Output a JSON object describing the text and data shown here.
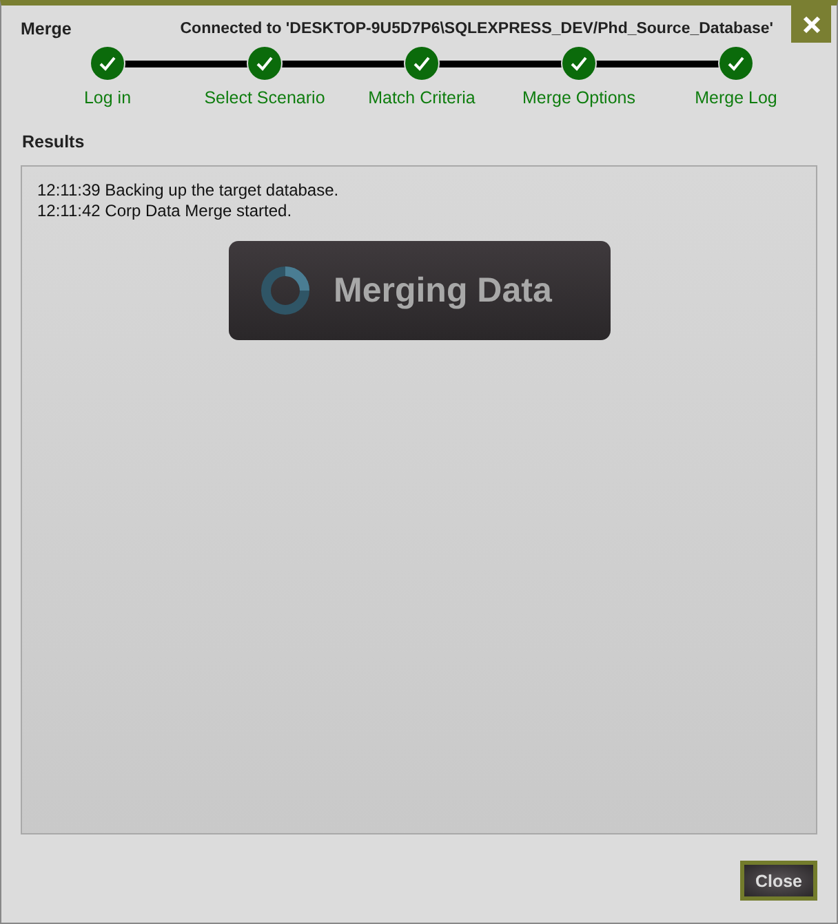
{
  "window": {
    "title": "Merge",
    "connection": "Connected to 'DESKTOP-9U5D7P6\\SQLEXPRESS_DEV/Phd_Source_Database'"
  },
  "steps": [
    {
      "label": "Log in",
      "completed": true
    },
    {
      "label": "Select Scenario",
      "completed": true
    },
    {
      "label": "Match Criteria",
      "completed": true
    },
    {
      "label": "Merge Options",
      "completed": true
    },
    {
      "label": "Merge Log",
      "completed": true
    }
  ],
  "results": {
    "heading": "Results",
    "lines": [
      "12:11:39 Backing up the target database.",
      "12:11:42 Corp Data Merge started."
    ],
    "overlay": "Merging Data"
  },
  "buttons": [
    "Close"
  ]
}
